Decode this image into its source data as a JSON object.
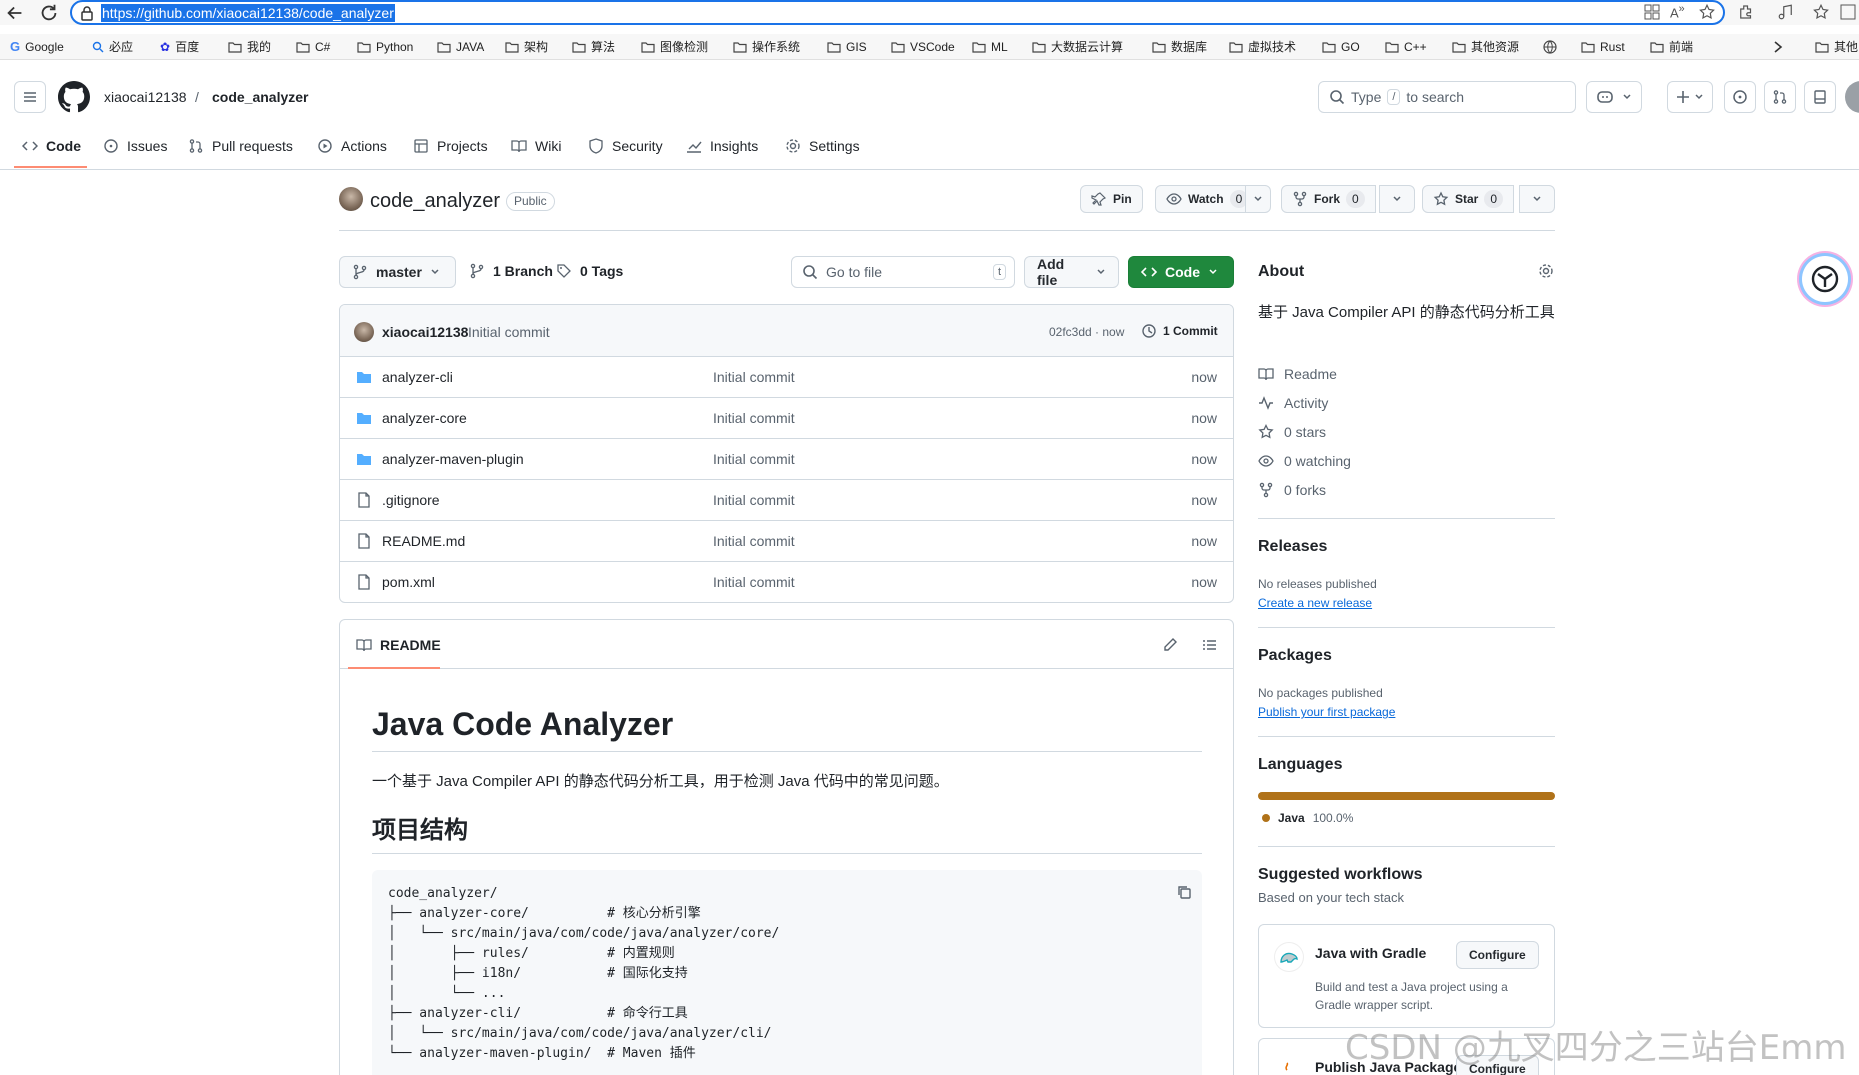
{
  "browser": {
    "url": "https://github.com/xiaocai12138/code_analyzer",
    "bookmarks": [
      "Google",
      "必应",
      "百度",
      "我的",
      "C#",
      "Python",
      "JAVA",
      "架构",
      "算法",
      "图像检测",
      "操作系统",
      "GIS",
      "VSCode",
      "ML",
      "大数据云计算",
      "数据库",
      "虚拟技术",
      "GO",
      "C++",
      "其他资源",
      "",
      "Rust",
      "前端",
      "其他"
    ]
  },
  "header": {
    "owner": "xiaocai12138",
    "separator": "/",
    "repo": "code_analyzer",
    "search_prefix": "Type",
    "search_key": "/",
    "search_suffix": "to search"
  },
  "tabs": [
    {
      "label": "Code",
      "icon": "code-icon"
    },
    {
      "label": "Issues",
      "icon": "issue-icon"
    },
    {
      "label": "Pull requests",
      "icon": "pull-request-icon"
    },
    {
      "label": "Actions",
      "icon": "play-icon"
    },
    {
      "label": "Projects",
      "icon": "table-icon"
    },
    {
      "label": "Wiki",
      "icon": "book-icon"
    },
    {
      "label": "Security",
      "icon": "shield-icon"
    },
    {
      "label": "Insights",
      "icon": "graph-icon"
    },
    {
      "label": "Settings",
      "icon": "gear-icon"
    }
  ],
  "repo": {
    "name": "code_analyzer",
    "visibility": "Public",
    "pin_label": "Pin",
    "watch_label": "Watch",
    "watch_count": "0",
    "fork_label": "Fork",
    "fork_count": "0",
    "star_label": "Star",
    "star_count": "0"
  },
  "toolbar": {
    "branch": "master",
    "branches": "1 Branch",
    "tags": "0 Tags",
    "goto_placeholder": "Go to file",
    "goto_key": "t",
    "add_file": "Add file",
    "code": "Code"
  },
  "commit": {
    "author": "xiaocai12138",
    "message": "Initial commit",
    "hash_time": "02fc3dd · now",
    "count": "1 Commit"
  },
  "files": [
    {
      "name": "analyzer-cli",
      "type": "folder",
      "message": "Initial commit",
      "time": "now"
    },
    {
      "name": "analyzer-core",
      "type": "folder",
      "message": "Initial commit",
      "time": "now"
    },
    {
      "name": "analyzer-maven-plugin",
      "type": "folder",
      "message": "Initial commit",
      "time": "now"
    },
    {
      "name": ".gitignore",
      "type": "file",
      "message": "Initial commit",
      "time": "now"
    },
    {
      "name": "README.md",
      "type": "file",
      "message": "Initial commit",
      "time": "now"
    },
    {
      "name": "pom.xml",
      "type": "file",
      "message": "Initial commit",
      "time": "now"
    }
  ],
  "readme": {
    "tab": "README",
    "title": "Java Code Analyzer",
    "intro": "一个基于 Java Compiler API 的静态代码分析工具，用于检测 Java 代码中的常见问题。",
    "section": "项目结构",
    "code": "code_analyzer/\n├── analyzer-core/          # 核心分析引擎\n│   └── src/main/java/com/code/java/analyzer/core/\n│       ├── rules/          # 内置规则\n│       ├── i18n/           # 国际化支持\n│       └── ...\n├── analyzer-cli/           # 命令行工具\n│   └── src/main/java/com/code/java/analyzer/cli/\n└── analyzer-maven-plugin/  # Maven 插件"
  },
  "about": {
    "heading": "About",
    "description": "基于 Java Compiler API 的静态代码分析工具",
    "items": [
      {
        "icon": "book-icon",
        "label": "Readme"
      },
      {
        "icon": "pulse-icon",
        "label": "Activity"
      },
      {
        "icon": "star-icon",
        "label": "0 stars"
      },
      {
        "icon": "eye-icon",
        "label": "0 watching"
      },
      {
        "icon": "fork-icon",
        "label": "0 forks"
      }
    ]
  },
  "releases": {
    "heading": "Releases",
    "empty": "No releases published",
    "link": "Create a new release"
  },
  "packages": {
    "heading": "Packages",
    "empty": "No packages published",
    "link": "Publish your first package"
  },
  "languages": {
    "heading": "Languages",
    "name": "Java",
    "percent": "100.0%",
    "fraction": 1.0,
    "color": "#b07219"
  },
  "workflows": {
    "heading": "Suggested workflows",
    "sub": "Based on your tech stack",
    "items": [
      {
        "title": "Java with Gradle",
        "desc": "Build and test a Java project using a Gradle wrapper script.",
        "button": "Configure"
      },
      {
        "title": "Publish Java Package",
        "desc": "",
        "button": "Configure"
      }
    ]
  },
  "watermark": "CSDN @九叉四分之三站台Emm"
}
